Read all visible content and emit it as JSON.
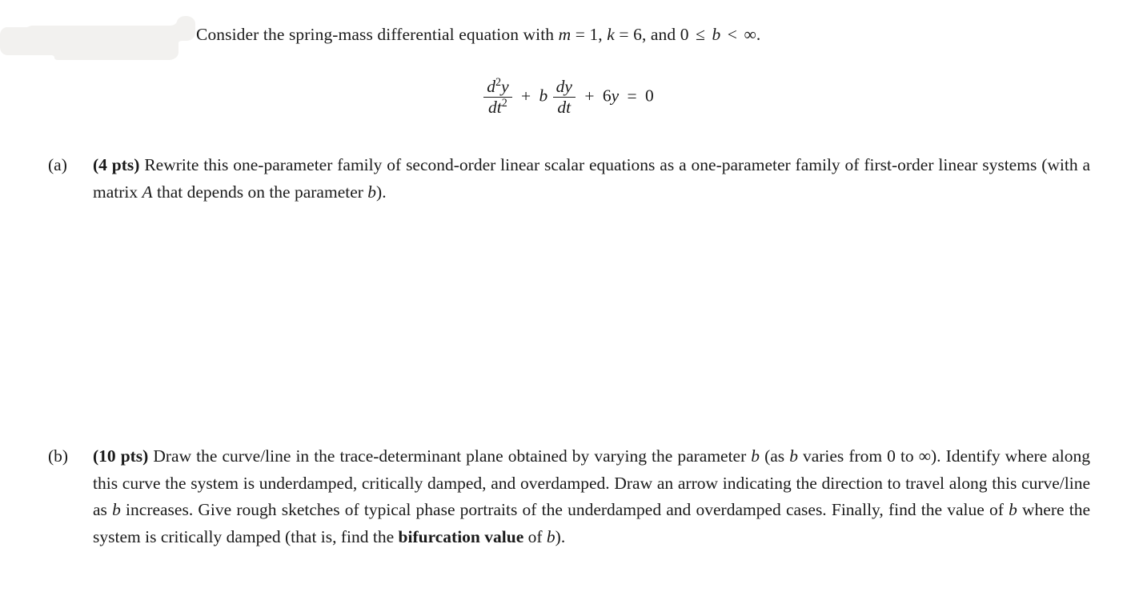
{
  "document": {
    "background_color": "#ffffff",
    "text_color": "#1a1a1a"
  },
  "redaction": {
    "name": "redaction-blob",
    "color": "#f2f1ef",
    "description": "hand-drawn light gray brush stroke covering name field"
  },
  "intro": {
    "text_before_m": "Consider the spring-mass differential equation with ",
    "m_symbol": "m",
    "m_eq": " = 1, ",
    "k_symbol": "k",
    "k_eq": " = 6, and 0 ",
    "leq": "≤",
    "b_symbol": "b",
    "lt": " < ",
    "infinity": "∞",
    "period": "."
  },
  "equation": {
    "latex": "d^2y/dt^2 + b dy/dt + 6y = 0",
    "num1": "d",
    "num1_exp": "2",
    "num1_var": "y",
    "den1": "dt",
    "den1_exp": "2",
    "plus1": "+",
    "coef_b": "b",
    "num2": "dy",
    "den2": "dt",
    "plus2": "+",
    "term3_num": "6",
    "term3_var": "y",
    "equals": "=",
    "rhs": "0"
  },
  "items": [
    {
      "label": "(a)",
      "points": "(4 pts)",
      "text": "Rewrite this one-parameter family of second-order linear scalar equations as a one-parameter family of first-order linear systems (with a matrix A that depends on the parameter b)."
    },
    {
      "label": "(b)",
      "points": "(10 pts)",
      "text": "Draw the curve/line in the trace-determinant plane obtained by varying the parameter b (as b varies from 0 to ∞). Identify where along this curve the system is underdamped, critically damped, and overdamped. Draw an arrow indicating the direction to travel along this curve/line as b increases. Give rough sketches of typical phase portraits of the underdamped and overdamped cases. Finally, find the value of b where the system is critically damped (that is, find the bifurcation value of b).",
      "bold_phrase": "bifurcation value"
    }
  ],
  "item_a_parts": {
    "p1": "Rewrite this one-parameter family of second-order linear scalar equations as a one-parameter family of first-order linear systems (with a matrix ",
    "var_A": "A",
    "p2": " that depends on the parameter ",
    "var_b": "b",
    "p3": ")."
  },
  "item_b_parts": {
    "p1": "Draw the curve/line in the trace-determinant plane obtained by varying the parameter ",
    "var_b1": "b",
    "p2": " (as ",
    "var_b2": "b",
    "p3": " varies from 0 to ∞). Identify where along this curve the system is underdamped, critically damped, and overdamped. Draw an arrow indicating the direction to travel along this curve/line as ",
    "var_b3": "b",
    "p4": " increases. Give rough sketches of typical phase portraits of the underdamped and overdamped cases. Finally, find the value of ",
    "var_b4": "b",
    "p5": " where the system is critically damped (that is, find the ",
    "bold_phrase": "bifurcation value",
    "p6": " of ",
    "var_b5": "b",
    "p7": ")."
  }
}
